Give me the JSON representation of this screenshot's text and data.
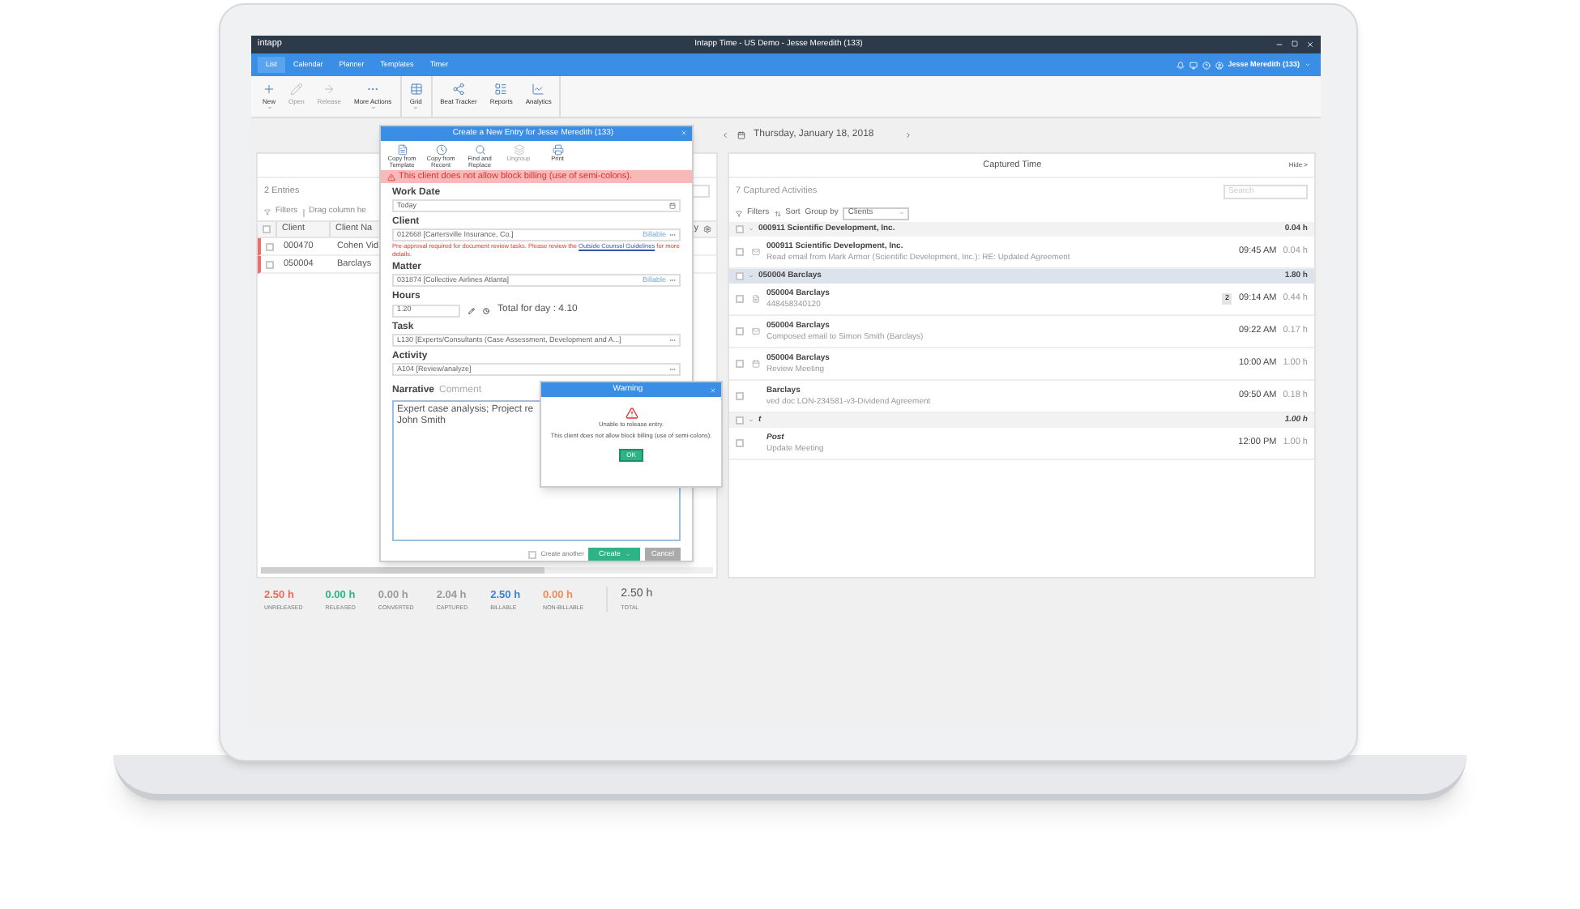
{
  "window": {
    "logo": "intapp",
    "title": "Intapp Time - US Demo - Jesse Meredith (133)",
    "user": "Jesse Meredith (133)"
  },
  "nav_tabs": [
    {
      "label": "List",
      "selected": true
    },
    {
      "label": "Calendar",
      "selected": false
    },
    {
      "label": "Planner",
      "selected": false
    },
    {
      "label": "Templates",
      "selected": false
    },
    {
      "label": "Timer",
      "selected": false
    }
  ],
  "toolbar": [
    [
      {
        "label": "New",
        "disabled": false,
        "has_menu": true
      },
      {
        "label": "Open",
        "disabled": true,
        "has_menu": false
      },
      {
        "label": "Release",
        "disabled": true,
        "has_menu": false
      },
      {
        "label": "More Actions",
        "disabled": false,
        "has_menu": true
      }
    ],
    [
      {
        "label": "Grid",
        "disabled": false,
        "has_menu": true
      }
    ],
    [
      {
        "label": "Beat Tracker",
        "disabled": false,
        "has_menu": false
      },
      {
        "label": "Reports",
        "disabled": false,
        "has_menu": false
      },
      {
        "label": "Analytics",
        "disabled": false,
        "has_menu": false
      }
    ]
  ],
  "date_nav": {
    "date": "Thursday, January 18, 2018"
  },
  "entries": {
    "all_checked": false,
    "count": "2 Entries",
    "filters": "Filters",
    "drag_hint": "Drag column he",
    "columns": [
      "Client",
      "Client Na",
      "y"
    ],
    "rows": [
      {
        "cells": [
          "000470",
          "Cohen Vid"
        ],
        "flagged": true,
        "checked": false
      },
      {
        "cells": [
          "050004",
          "Barclays"
        ],
        "flagged": true,
        "checked": false
      }
    ]
  },
  "entry_dialog": {
    "title": "Create a New Entry for Jesse Meredith (133)",
    "tools": [
      {
        "label": "Copy from Template",
        "disabled": false
      },
      {
        "label": "Copy from Recent",
        "disabled": false
      },
      {
        "label": "Find and Replace",
        "disabled": false
      },
      {
        "label": "Ungroup",
        "disabled": true
      },
      {
        "label": "Print",
        "disabled": false
      }
    ],
    "alert": "This client does not allow block billing (use of semi-colons).",
    "fields": [
      {
        "kind": "date",
        "label": "Work Date",
        "value": "Today"
      },
      {
        "kind": "lookup",
        "label": "Client",
        "value": "012668 [Cartersville Insurance, Co.]",
        "badge": "Billable",
        "note": "Pre-approval required for document review tasks. Please review the",
        "link": "Outside Counsel Guidelines",
        "note_end": "for more details."
      },
      {
        "kind": "lookup",
        "label": "Matter",
        "value": "031874 [Collective Airlines Atlanta]",
        "badge": "Billable"
      },
      {
        "kind": "hours",
        "label": "Hours",
        "value": "1.20",
        "total": "Total for day : 4.10"
      },
      {
        "kind": "lookup",
        "label": "Task",
        "value": "L130 [Experts/Consultants (Case Assessment, Development and A...]"
      },
      {
        "kind": "lookup",
        "label": "Activity",
        "value": "A104 [Review/analyze]"
      }
    ],
    "narrative_tabs": [
      {
        "label": "Narrative",
        "selected": true
      },
      {
        "label": "Comment",
        "selected": false
      }
    ],
    "narrative": [
      "Expert case analysis; Project re",
      "John Smith"
    ],
    "create_another": {
      "label": "Create another",
      "checked": false
    },
    "create": "Create",
    "cancel": "Cancel"
  },
  "warning": {
    "title": "Warning",
    "lines": [
      "Unable to release entry.",
      "This client does not allow block billing (use of semi-colons)."
    ],
    "ok": "OK"
  },
  "captured": {
    "title": "Captured Time",
    "hide": "Hide >",
    "count": "7 Captured Activities",
    "search_placeholder": "Search",
    "filters": "Filters",
    "sort": "Sort",
    "group_by": "Group by",
    "group_value": "Clients",
    "groups": [
      {
        "label": "000911 Scientific Development, Inc.",
        "total": "0.04 h",
        "kind": "client",
        "selected": false,
        "checked": false,
        "items": [
          {
            "kind": "email",
            "checked": false,
            "title": "000911 Scientific Development, Inc.",
            "description": "Read email from Mark Armor (Scientific Development, Inc.): RE: Updated Agreement",
            "time": "09:45 AM",
            "hours": "0.04 h"
          }
        ]
      },
      {
        "label": "050004 Barclays",
        "total": "1.80 h",
        "kind": "client",
        "selected": true,
        "checked": false,
        "items": [
          {
            "kind": "document",
            "checked": false,
            "title": "050004 Barclays",
            "description": "448458340120",
            "count": "2",
            "time": "09:14 AM",
            "hours": "0.44 h"
          },
          {
            "kind": "email",
            "checked": false,
            "title": "050004 Barclays",
            "description": "Composed email to Simon Smith (Barclays)",
            "time": "09:22 AM",
            "hours": "0.17 h"
          },
          {
            "kind": "meeting",
            "checked": false,
            "title": "050004 Barclays",
            "description": "Review Meeting",
            "time": "10:00 AM",
            "hours": "1.00 h"
          },
          {
            "kind": "covered",
            "checked": false,
            "title": "Barclays",
            "description": "ved doc LON-234581-v3-Dividend Agreement",
            "time": "09:50 AM",
            "hours": "0.18 h"
          }
        ]
      },
      {
        "label": "t",
        "total": "1.00 h",
        "kind": "unassigned",
        "selected": false,
        "checked": false,
        "items": [
          {
            "kind": "covered",
            "checked": false,
            "title": "Post",
            "description": "Update Meeting",
            "time": "12:00 PM",
            "hours": "1.00 h"
          }
        ]
      }
    ]
  },
  "summary": [
    {
      "value": "2.50 h",
      "label": "UNRELEASED",
      "color": "#f2695a"
    },
    {
      "value": "0.00 h",
      "label": "RELEASED",
      "color": "#2db385"
    },
    {
      "value": "0.00 h",
      "label": "CONVERTED",
      "color": "#9a9a9a"
    },
    {
      "value": "2.04 h",
      "label": "CAPTURED",
      "color": "#9a9a9a"
    },
    {
      "value": "2.50 h",
      "label": "BILLABLE",
      "color": "#3b82d6"
    },
    {
      "value": "0.00 h",
      "label": "NON-BILLABLE",
      "color": "#f28a5b"
    }
  ],
  "total": {
    "value": "2.50 h",
    "label": "TOTAL"
  }
}
